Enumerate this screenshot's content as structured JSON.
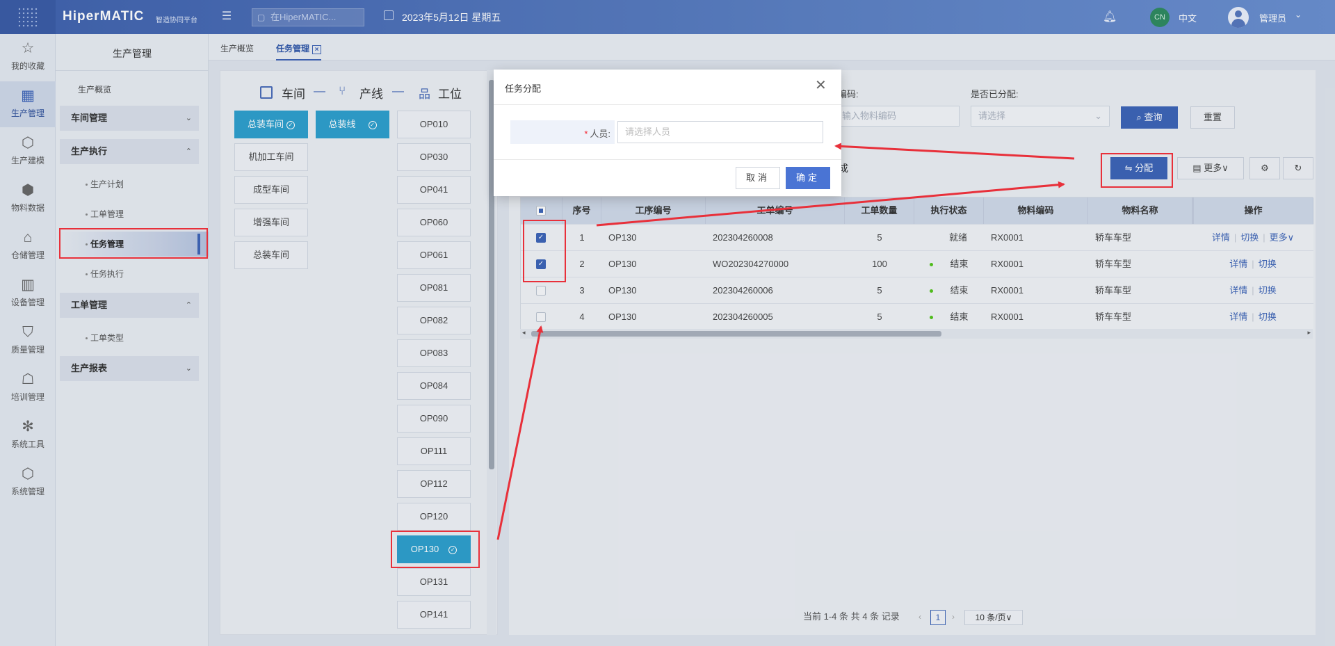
{
  "topbar": {
    "brand": "HiperMATIC",
    "brand_sub": "智造协同平台",
    "search_placeholder": "在HiperMATIC...",
    "date": "2023年5月12日 星期五",
    "lang_badge": "CN",
    "lang": "中文",
    "user": "管理员"
  },
  "rail": {
    "items": [
      {
        "label": "我的收藏",
        "icon": "star-icon"
      },
      {
        "label": "生产管理",
        "icon": "factory-icon"
      },
      {
        "label": "生产建模",
        "icon": "cube-icon"
      },
      {
        "label": "物料数据",
        "icon": "box-icon"
      },
      {
        "label": "仓储管理",
        "icon": "warehouse-icon"
      },
      {
        "label": "设备管理",
        "icon": "device-icon"
      },
      {
        "label": "质量管理",
        "icon": "shield-icon"
      },
      {
        "label": "培训管理",
        "icon": "training-icon"
      },
      {
        "label": "系统工具",
        "icon": "network-icon"
      },
      {
        "label": "系统管理",
        "icon": "settings-cube-icon"
      }
    ]
  },
  "sidebar": {
    "title": "生产管理",
    "overview": "生产概览",
    "workshop": "车间管理",
    "exec": "生产执行",
    "plan": "生产计划",
    "workorder": "工单管理",
    "task": "任务管理",
    "taskexec": "任务执行",
    "wo_mgmt": "工单管理",
    "wo_type": "工单类型",
    "report": "生产报表"
  },
  "tabs": {
    "overview": "生产概览",
    "task": "任务管理",
    "close": "×"
  },
  "hierarchy": {
    "workshop_label": "车间",
    "line_label": "产线",
    "station_label": "工位",
    "workshops": [
      "总装车间",
      "机加工车间",
      "成型车间",
      "增强车间",
      "总装车间"
    ],
    "lines": [
      "总装线"
    ],
    "stations": [
      "OP010",
      "OP030",
      "OP041",
      "OP060",
      "OP061",
      "OP081",
      "OP082",
      "OP083",
      "OP084",
      "OP090",
      "OP111",
      "OP112",
      "OP120",
      "OP130",
      "OP131",
      "OP141"
    ]
  },
  "filters": {
    "material_code_label": "编码:",
    "material_code_placeholder": "输入物料编码",
    "assigned_label": "是否已分配:",
    "assigned_placeholder": "请选择",
    "query": "查询",
    "reset": "重置"
  },
  "table": {
    "title_suffix": "成",
    "assign_btn": "分配",
    "more_btn": "更多",
    "headers": [
      "序号",
      "工序编号",
      "工单编号",
      "工单数量",
      "执行状态",
      "物料编码",
      "物料名称",
      "操作"
    ],
    "rows": [
      {
        "no": "1",
        "op": "OP130",
        "wo": "202304260008",
        "qty": "5",
        "status": "就绪",
        "code": "RX0001",
        "name": "轿车车型",
        "a1": "详情",
        "a2": "切换",
        "a3": "更多"
      },
      {
        "no": "2",
        "op": "OP130",
        "wo": "WO202304270000",
        "qty": "100",
        "status": "结束",
        "code": "RX0001",
        "name": "轿车车型",
        "a1": "详情",
        "a2": "切换",
        "a3": ""
      },
      {
        "no": "3",
        "op": "OP130",
        "wo": "202304260006",
        "qty": "5",
        "status": "结束",
        "code": "RX0001",
        "name": "轿车车型",
        "a1": "详情",
        "a2": "切换",
        "a3": ""
      },
      {
        "no": "4",
        "op": "OP130",
        "wo": "202304260005",
        "qty": "5",
        "status": "结束",
        "code": "RX0001",
        "name": "轿车车型",
        "a1": "详情",
        "a2": "切换",
        "a3": ""
      }
    ]
  },
  "pager": {
    "summary": "当前 1-4 条 共 4 条 记录",
    "page": "1",
    "size": "10 条/页"
  },
  "modal": {
    "title": "任务分配",
    "label": "人员:",
    "required": "*",
    "placeholder": "请选择人员",
    "cancel": "取消",
    "ok": "确定"
  },
  "colors": {
    "accent": "#3c63b6",
    "selected_cell": "#2d9fcc",
    "annotation": "#e8303a"
  }
}
